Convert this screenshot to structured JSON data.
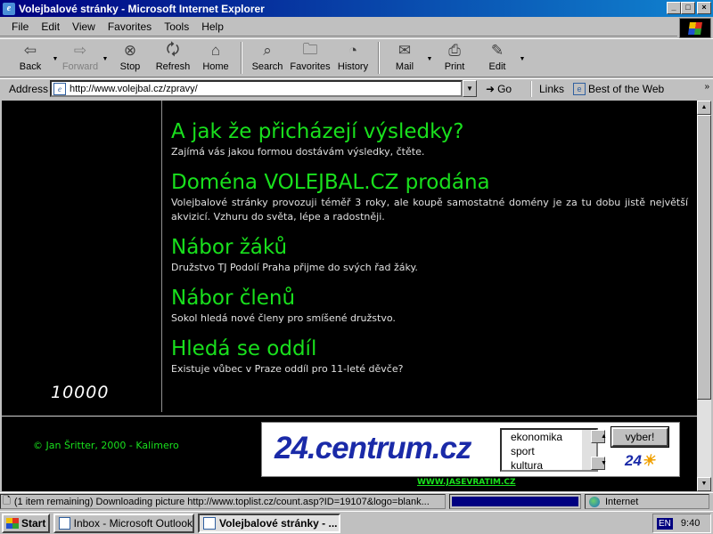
{
  "window": {
    "title": "Volejbalové stránky - Microsoft Internet Explorer",
    "buttons": {
      "minimize": "_",
      "maximize": "□",
      "close": "×"
    }
  },
  "menu": [
    "File",
    "Edit",
    "View",
    "Favorites",
    "Tools",
    "Help"
  ],
  "toolbar": {
    "back": "Back",
    "forward": "Forward",
    "stop": "Stop",
    "refresh": "Refresh",
    "home": "Home",
    "search": "Search",
    "favorites": "Favorites",
    "history": "History",
    "mail": "Mail",
    "print": "Print",
    "edit": "Edit"
  },
  "address": {
    "label": "Address",
    "url": "http://www.volejbal.cz/zpravy/",
    "go": "Go",
    "links": "Links",
    "best_of_web": "Best of the Web"
  },
  "page": {
    "counter": "10000",
    "news": [
      {
        "title": "A jak že přicházejí výsledky?",
        "text": "Zajímá vás jakou formou dostávám výsledky, čtěte."
      },
      {
        "title": "Doména VOLEJBAL.CZ prodána",
        "text": "Volejbalové stránky provozuji téměř 3 roky, ale koupě samostatné domény je za tu dobu jistě největší akvizicí. Vzhuru do světa, lépe a radostněji."
      },
      {
        "title": "Nábor žáků",
        "text": "Družstvo TJ Podolí Praha přijme do svých řad žáky."
      },
      {
        "title": "Nábor členů",
        "text": "Sokol hledá nové členy pro smíšené družstvo."
      },
      {
        "title": "Hledá se oddíl",
        "text": "Existuje vůbec v Praze oddíl pro 11-leté děvče?"
      }
    ],
    "copyright": "© Jan Šritter, 2000 - Kalimero",
    "banner": {
      "logo": "24.centrum.cz",
      "options": [
        "ekonomika",
        "sport",
        "kultura"
      ],
      "button": "vyber!",
      "mini_logo_a": "24",
      "mini_logo_b": "",
      "footer_link": "WWW.JASEVRATIM.CZ"
    }
  },
  "status": {
    "text": "(1 item remaining) Downloading picture http://www.toplist.cz/count.asp?ID=19107&logo=blank...",
    "progress": 1.0,
    "zone": "Internet"
  },
  "taskbar": {
    "start": "Start",
    "tasks": [
      {
        "label": "Inbox - Microsoft Outlook",
        "active": false
      },
      {
        "label": "Volejbalové stránky - ...",
        "active": true
      }
    ],
    "lang": "EN",
    "clock": "9:40"
  }
}
